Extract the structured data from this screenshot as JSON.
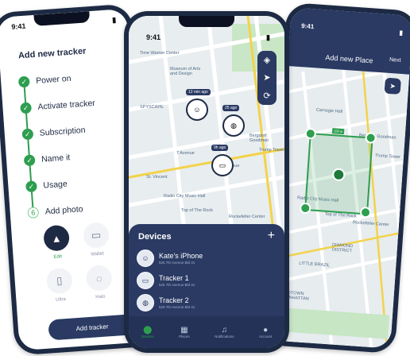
{
  "left_phone": {
    "time": "9:41",
    "title": "Add new tracker",
    "steps": [
      {
        "label": "Power on",
        "status": "done"
      },
      {
        "label": "Activate tracker",
        "status": "done"
      },
      {
        "label": "Subscription",
        "status": "done"
      },
      {
        "label": "Name it",
        "status": "done"
      },
      {
        "label": "Usage",
        "status": "done"
      },
      {
        "label": "Add photo",
        "status": "current",
        "number": "6"
      }
    ],
    "photo_options": [
      {
        "label": "Edit",
        "icon": "rocket-icon",
        "selected": true
      },
      {
        "label": "Wallet",
        "icon": "wallet-icon",
        "selected": false
      },
      {
        "label": "Ultra",
        "icon": "phone-icon",
        "selected": false
      },
      {
        "label": "Halo",
        "icon": "drop-icon",
        "selected": false
      }
    ],
    "button": "Add tracker"
  },
  "middle_phone": {
    "time": "9:41",
    "map_labels": [
      "Time Warner Center",
      "Museum of Arts and Design",
      "SPYSCAPE",
      "Bergdorf Goodman",
      "Trump Tower",
      "Radio City Music Hall",
      "Top of The Rock",
      "Rockefeller Center",
      "7 Avenue",
      "5th Avenue",
      "St. Vincent"
    ],
    "pins": [
      {
        "tag": "12 min ago"
      },
      {
        "tag": "25 ago"
      },
      {
        "tag": "9h ago"
      }
    ],
    "devices_title": "Devices",
    "devices": [
      {
        "name": "Kate's iPhone",
        "address": "525 7th Avenue Bld 31"
      },
      {
        "name": "Tracker 1",
        "address": "525 7th Avenue Bld 31"
      },
      {
        "name": "Tracker 2",
        "address": "525 7th Avenue Bld 31"
      }
    ],
    "tabs": [
      {
        "label": "Devices",
        "icon": "location-icon",
        "active": true
      },
      {
        "label": "Places",
        "icon": "building-icon",
        "active": false
      },
      {
        "label": "Notifications",
        "icon": "bell-icon",
        "active": false
      },
      {
        "label": "Account",
        "icon": "user-icon",
        "active": false
      }
    ]
  },
  "right_phone": {
    "time": "9:41",
    "title": "Add new Place",
    "next": "Next",
    "map_labels": [
      "Carnegie Hall",
      "Bergdorf Goodman",
      "Trump Tower",
      "Radio City Music Hall",
      "Top of The Rock",
      "Rockefeller Center",
      "DIAMOND DISTRICT",
      "LITTLE BRAZIL",
      "MIDTOWN MANHATTAN"
    ],
    "area_tag": "150 m"
  },
  "colors": {
    "navy": "#2a3a63",
    "green": "#2e9e4f",
    "map": "#e9eef0"
  }
}
